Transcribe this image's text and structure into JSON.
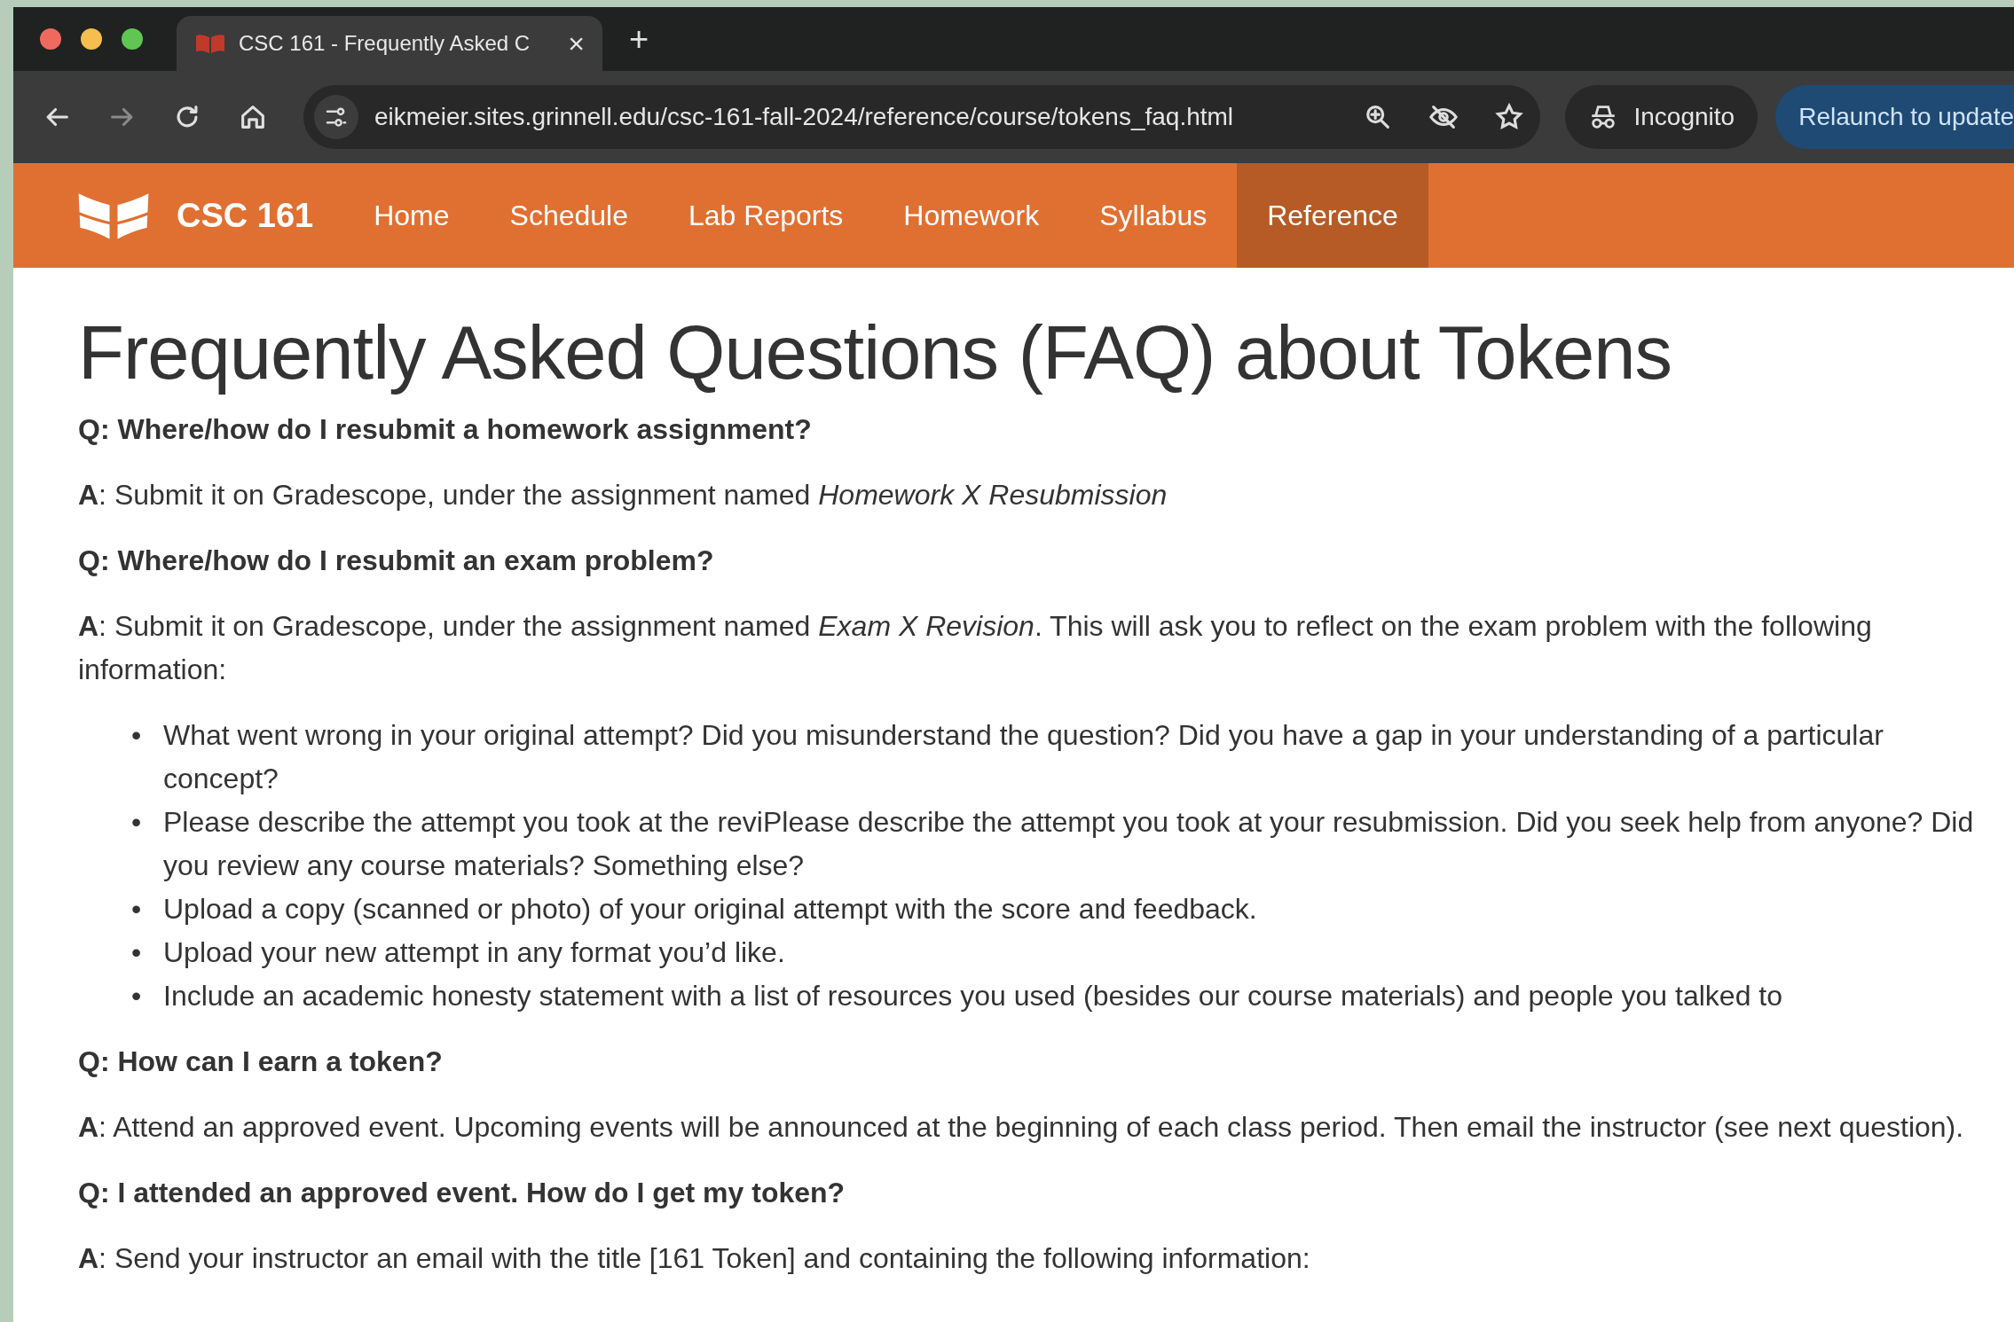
{
  "browser": {
    "tab": {
      "title": "CSC 161 - Frequently Asked C",
      "close": "×"
    },
    "new_tab": "+",
    "nav_buttons": [
      {
        "kind": "back",
        "disabled": false
      },
      {
        "kind": "forward",
        "disabled": true
      },
      {
        "kind": "reload",
        "disabled": false
      },
      {
        "kind": "home",
        "disabled": false
      }
    ],
    "url": "eikmeier.sites.grinnell.edu/csc-161-fall-2024/reference/course/tokens_faq.html",
    "profile": "Incognito",
    "update_button": "Relaunch to update"
  },
  "site_nav": {
    "brand": "CSC 161",
    "items": [
      {
        "label": "Home",
        "selected": false
      },
      {
        "label": "Schedule",
        "selected": false
      },
      {
        "label": "Lab Reports",
        "selected": false
      },
      {
        "label": "Homework",
        "selected": false
      },
      {
        "label": "Syllabus",
        "selected": false
      },
      {
        "label": "Reference",
        "selected": true
      }
    ]
  },
  "page": {
    "title": "Frequently Asked Questions (FAQ) about Tokens",
    "blocks": [
      {
        "kind": "question",
        "text": "Q: Where/how do I resubmit a homework assignment?"
      },
      {
        "kind": "answer",
        "text": "**A**: Submit it on Gradescope, under the assignment named *Homework X Resubmission*"
      },
      {
        "kind": "question",
        "text": "Q: Where/how do I resubmit an exam problem?"
      },
      {
        "kind": "answer",
        "text": "**A**: Submit it on Gradescope, under the assignment named *Exam X Revision*. This will ask you to reflect on the exam problem with the following information:"
      },
      {
        "kind": "list",
        "items": [
          {
            "marker": "•",
            "text": "What went wrong in your original attempt? Did you misunderstand the question? Did you have a gap in your understanding of a particular concept?"
          },
          {
            "marker": "•",
            "text": "Please describe the attempt you took at the reviPlease describe the attempt you took at your resubmission. Did you seek help from anyone? Did you review any course materials? Something else?"
          },
          {
            "marker": "•",
            "text": "Upload a copy (scanned or photo) of your original attempt with the score and feedback."
          },
          {
            "marker": "•",
            "text": "Upload your new attempt in any format you’d like."
          },
          {
            "marker": "•",
            "text": "Include an academic honesty statement with a list of resources you used (besides our course materials) and people you talked to"
          }
        ]
      },
      {
        "kind": "question",
        "text": "Q: How can I earn a token?"
      },
      {
        "kind": "answer",
        "text": "**A**: Attend an approved event. Upcoming events will be announced at the beginning of each class period. Then email the instructor (see next question)."
      },
      {
        "kind": "question",
        "text": "Q: I attended an approved event. How do I get my token?"
      },
      {
        "kind": "answer",
        "text": "**A**: Send your instructor an email with the title [161 Token] and containing the following information:"
      }
    ]
  }
}
